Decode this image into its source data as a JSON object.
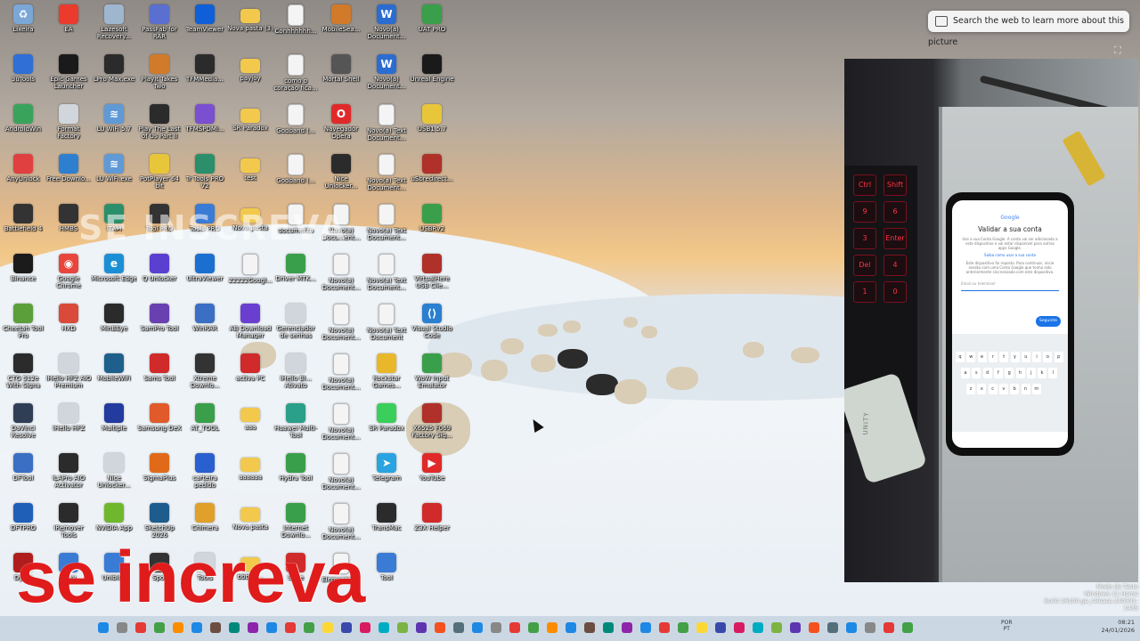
{
  "desktop": {
    "icons": [
      {
        "label": "Lixeira",
        "icon": "recycle-bin-icon",
        "color": "#7aa7d6"
      },
      {
        "label": "3uTools",
        "icon": "app-icon",
        "color": "#2f6fd6"
      },
      {
        "label": "AndroidWin",
        "icon": "app-icon",
        "color": "#3aa35b"
      },
      {
        "label": "AnyUnlock",
        "icon": "app-icon",
        "color": "#e04040"
      },
      {
        "label": "Battlefield 4",
        "icon": "app-icon",
        "color": "#333333"
      },
      {
        "label": "Binance",
        "icon": "app-icon",
        "color": "#1b1b1b"
      },
      {
        "label": "Cheetah Tool Pro",
        "icon": "app-icon",
        "color": "#5a9f3a"
      },
      {
        "label": "CTG 512e With Signa",
        "icon": "app-icon",
        "color": "#2b2b2b"
      },
      {
        "label": "DaVinci Resolve",
        "icon": "app-icon",
        "color": "#2f3e54"
      },
      {
        "label": "DFTool",
        "icon": "app-icon",
        "color": "#3a6fc4"
      },
      {
        "label": "DFTPRO",
        "icon": "app-icon",
        "color": "#1f5fb8"
      },
      {
        "label": "Dying",
        "icon": "app-icon",
        "color": "#b01d1d"
      },
      {
        "label": "EA",
        "icon": "app-icon",
        "color": "#ea3b2d"
      },
      {
        "label": "Epic Games Launcher",
        "icon": "app-icon",
        "color": "#1a1a1a"
      },
      {
        "label": "Format Factory",
        "icon": "app-icon",
        "color": "#d0d6dc"
      },
      {
        "label": "Free Downlo...",
        "icon": "app-icon",
        "color": "#2e7fd0"
      },
      {
        "label": "HMBS",
        "icon": "app-icon",
        "color": "#333333"
      },
      {
        "label": "Google Chrome",
        "icon": "chrome-icon",
        "color": "#e8453c"
      },
      {
        "label": "HXD",
        "icon": "app-icon",
        "color": "#d94a3b"
      },
      {
        "label": "iHello HFZ AIO Premium",
        "icon": "app-icon",
        "color": "#d0d6dc"
      },
      {
        "label": "iHello HFZ",
        "icon": "app-icon",
        "color": "#d0d6dc"
      },
      {
        "label": "iLAPro AIO Activator",
        "icon": "app-icon",
        "color": "#2b2b2b"
      },
      {
        "label": "iRemover Tools",
        "icon": "app-icon",
        "color": "#2b2b2b"
      },
      {
        "label": "iPlay",
        "icon": "app-icon",
        "color": "#3a7bd5"
      },
      {
        "label": "Lazesoft Recovery...",
        "icon": "app-icon",
        "color": "#9fb6cf"
      },
      {
        "label": "LPro Max.exe",
        "icon": "app-icon",
        "color": "#2b2b2b"
      },
      {
        "label": "LU WiFi 5.7",
        "icon": "wifi-icon",
        "color": "#5f9ad6"
      },
      {
        "label": "LU WiFi.exe",
        "icon": "wifi-icon",
        "color": "#5f9ad6"
      },
      {
        "label": "ITAM",
        "icon": "app-icon",
        "color": "#2a8f6a"
      },
      {
        "label": "Microsoft Edge",
        "icon": "edge-icon",
        "color": "#1a8fd6"
      },
      {
        "label": "MinBEye",
        "icon": "app-icon",
        "color": "#2b2b2b"
      },
      {
        "label": "MobileWiFi",
        "icon": "app-icon",
        "color": "#1e5f8c"
      },
      {
        "label": "Multiple",
        "icon": "app-icon",
        "color": "#233a9e"
      },
      {
        "label": "Nice Unlocker...",
        "icon": "app-icon",
        "color": "#d0d6dc"
      },
      {
        "label": "NVIDIA App",
        "icon": "app-icon",
        "color": "#6fb82d"
      },
      {
        "label": "Uniblue",
        "icon": "app-icon",
        "color": "#3a7bd5"
      },
      {
        "label": "PassFab for RAR",
        "icon": "app-icon",
        "color": "#5a6fd0"
      },
      {
        "label": "PlayIt Takes Two",
        "icon": "app-icon",
        "color": "#d07a2a"
      },
      {
        "label": "Play The Last of Us Part II",
        "icon": "app-icon",
        "color": "#2b2b2b"
      },
      {
        "label": "PotPlayer 64 bit",
        "icon": "app-icon",
        "color": "#e8c63a"
      },
      {
        "label": "Tool PRO",
        "icon": "app-icon",
        "color": "#333333"
      },
      {
        "label": "Q Unlocker",
        "icon": "app-icon",
        "color": "#5a3fd0"
      },
      {
        "label": "SamPro Tool",
        "icon": "app-icon",
        "color": "#6a3fb0"
      },
      {
        "label": "Sams Tool",
        "icon": "app-icon",
        "color": "#d02a2a"
      },
      {
        "label": "Samsung DeX",
        "icon": "app-icon",
        "color": "#e05a2a"
      },
      {
        "label": "SigmaPlus",
        "icon": "app-icon",
        "color": "#e06a1a"
      },
      {
        "label": "SketchUp 2026",
        "icon": "app-icon",
        "color": "#1d5c8c"
      },
      {
        "label": "Spot",
        "icon": "app-icon",
        "color": "#333333"
      },
      {
        "label": "TeamViewer",
        "icon": "app-icon",
        "color": "#0e5fd8"
      },
      {
        "label": "TFMMedia...",
        "icon": "app-icon",
        "color": "#2b2b2b"
      },
      {
        "label": "TFMSPDMi...",
        "icon": "app-icon",
        "color": "#7a4fd0"
      },
      {
        "label": "Tr Tools PRO V2",
        "icon": "app-icon",
        "color": "#2a8f6a"
      },
      {
        "label": "Tools PRO",
        "icon": "app-icon",
        "color": "#3a7bd5"
      },
      {
        "label": "UltraViewer",
        "icon": "app-icon",
        "color": "#1a6fd0"
      },
      {
        "label": "WinRAR",
        "icon": "app-icon",
        "color": "#3a6fc4"
      },
      {
        "label": "Xtreme Downlo...",
        "icon": "app-icon",
        "color": "#333333"
      },
      {
        "label": "AT_TOOL",
        "icon": "app-icon",
        "color": "#3a9f4a"
      },
      {
        "label": "carteira pedido",
        "icon": "app-icon",
        "color": "#2a5fd0"
      },
      {
        "label": "Chimera",
        "icon": "app-icon",
        "color": "#e0a02a"
      },
      {
        "label": "Tools",
        "icon": "app-icon",
        "color": "#d0d6dc"
      },
      {
        "label": "Nova pasta (3)",
        "icon": "folder-icon",
        "color": "#f2c94c"
      },
      {
        "label": "payjoy",
        "icon": "folder-icon",
        "color": "#f2c94c"
      },
      {
        "label": "SR Paradox",
        "icon": "folder-icon",
        "color": "#f2c94c"
      },
      {
        "label": "test",
        "icon": "folder-icon",
        "color": "#f2c94c"
      },
      {
        "label": "Nova pasta",
        "icon": "folder-icon",
        "color": "#f2c94c"
      },
      {
        "label": "22222Googl...",
        "icon": "document-icon",
        "color": "#f4f4f4"
      },
      {
        "label": "AB Download Manager",
        "icon": "app-icon",
        "color": "#6a3fd0"
      },
      {
        "label": "activa PC",
        "icon": "app-icon",
        "color": "#d02a2a"
      },
      {
        "label": "aaa",
        "icon": "folder-icon",
        "color": "#f2c94c"
      },
      {
        "label": "aaaaaa",
        "icon": "folder-icon",
        "color": "#f2c94c"
      },
      {
        "label": "Nova pasta",
        "icon": "folder-icon",
        "color": "#f2c94c"
      },
      {
        "label": "bbbbb...",
        "icon": "folder-icon",
        "color": "#f2c94c"
      },
      {
        "label": "Conhhhhhh...",
        "icon": "document-icon",
        "color": "#f4f4f4"
      },
      {
        "label": "como o coração fica...",
        "icon": "document-icon",
        "color": "#f4f4f4"
      },
      {
        "label": "Godband (...",
        "icon": "document-icon",
        "color": "#f4f4f4"
      },
      {
        "label": "Godband (...",
        "icon": "document-icon",
        "color": "#f4f4f4"
      },
      {
        "label": "documento",
        "icon": "document-icon",
        "color": "#f4f4f4"
      },
      {
        "label": "Driver MTK...",
        "icon": "app-icon",
        "color": "#3a9f4a"
      },
      {
        "label": "Gerenciador de senhas",
        "icon": "app-icon",
        "color": "#d0d6dc"
      },
      {
        "label": "iHello Bl... Ativato",
        "icon": "app-icon",
        "color": "#d0d6dc"
      },
      {
        "label": "Huawei Multi-Tool",
        "icon": "app-icon",
        "color": "#2a9f8a"
      },
      {
        "label": "Hydra Tool",
        "icon": "app-icon",
        "color": "#3a9f4a"
      },
      {
        "label": "Internet Downlo...",
        "icon": "app-icon",
        "color": "#3a9f4a"
      },
      {
        "label": "Suite",
        "icon": "app-icon",
        "color": "#d02a2a"
      },
      {
        "label": "MobileSea...",
        "icon": "app-icon",
        "color": "#d07a2a"
      },
      {
        "label": "Mortal Shell",
        "icon": "app-icon",
        "color": "#555555"
      },
      {
        "label": "Navegador Opera",
        "icon": "opera-icon",
        "color": "#e02a2a"
      },
      {
        "label": "Nice Unlocker...",
        "icon": "app-icon",
        "color": "#2b2b2b"
      },
      {
        "label": "Novo(a) Document...",
        "icon": "document-icon",
        "color": "#f4f4f4"
      },
      {
        "label": "Novo(a) Document...",
        "icon": "document-icon",
        "color": "#f4f4f4"
      },
      {
        "label": "Novo(a) Document...",
        "icon": "document-icon",
        "color": "#f4f4f4"
      },
      {
        "label": "Novo(a) Document...",
        "icon": "document-icon",
        "color": "#f4f4f4"
      },
      {
        "label": "Novo(a) Document...",
        "icon": "document-icon",
        "color": "#f4f4f4"
      },
      {
        "label": "Novo(a) Document...",
        "icon": "document-icon",
        "color": "#f4f4f4"
      },
      {
        "label": "Novo(a) Document...",
        "icon": "document-icon",
        "color": "#f4f4f4"
      },
      {
        "label": "Elementos...",
        "icon": "document-icon",
        "color": "#f4f4f4"
      },
      {
        "label": "Novo(a) Document...",
        "icon": "word-icon",
        "color": "#2b6cd0"
      },
      {
        "label": "Novo(a) Document...",
        "icon": "word-icon",
        "color": "#2b6cd0"
      },
      {
        "label": "Novo(a) Text Document...",
        "icon": "document-icon",
        "color": "#f4f4f4"
      },
      {
        "label": "Novo(a) Text Document...",
        "icon": "document-icon",
        "color": "#f4f4f4"
      },
      {
        "label": "Novo(a) Text Document...",
        "icon": "document-icon",
        "color": "#f4f4f4"
      },
      {
        "label": "Novo(a) Text Document...",
        "icon": "document-icon",
        "color": "#f4f4f4"
      },
      {
        "label": "Novo(a) Text Document",
        "icon": "document-icon",
        "color": "#f4f4f4"
      },
      {
        "label": "Rockstar Games...",
        "icon": "app-icon",
        "color": "#e8b82a"
      },
      {
        "label": "SR Paradox",
        "icon": "app-icon",
        "color": "#3acf5a"
      },
      {
        "label": "Telegram",
        "icon": "telegram-icon",
        "color": "#2aa3e0"
      },
      {
        "label": "TransMac",
        "icon": "app-icon",
        "color": "#2b2b2b"
      },
      {
        "label": "Tool",
        "icon": "app-icon",
        "color": "#3a7bd5"
      },
      {
        "label": "UAT PRO",
        "icon": "app-icon",
        "color": "#3a9f4a"
      },
      {
        "label": "Unreal Engine",
        "icon": "app-icon",
        "color": "#1a1a1a"
      },
      {
        "label": "USB1.5.7",
        "icon": "app-icon",
        "color": "#e8c63a"
      },
      {
        "label": "uSbredirect...",
        "icon": "app-icon",
        "color": "#b0302a"
      },
      {
        "label": "USBRv2",
        "icon": "app-icon",
        "color": "#3a9f4a"
      },
      {
        "label": "VirtualHere USB Clie...",
        "icon": "app-icon",
        "color": "#b0302a"
      },
      {
        "label": "Visual Studio Code",
        "icon": "vscode-icon",
        "color": "#2a7fd0"
      },
      {
        "label": "WoW Input Emulator",
        "icon": "app-icon",
        "color": "#3a9f4a"
      },
      {
        "label": "X6525 F069 Factory Sig...",
        "icon": "app-icon",
        "color": "#b0302a"
      },
      {
        "label": "YouTube",
        "icon": "youtube-icon",
        "color": "#e02a2a"
      },
      {
        "label": "Z3X Helper",
        "icon": "app-icon",
        "color": "#d02a2a"
      }
    ]
  },
  "lens": {
    "banner_text": "Search the web to learn more about this picture"
  },
  "camera": {
    "keyboard_keys": [
      "Ctrl",
      "Shift",
      "9",
      "6",
      "3",
      "Enter",
      "Del",
      "4",
      "1",
      "0"
    ],
    "phone": {
      "logo": "Google",
      "title": "Validar a sua conta",
      "text": "Use a sua Conta Google. A conta vai ser adicionada a este dispositivo e vai estar disponível para outras apps Google.",
      "link": "Saiba como usar a sua conta",
      "text2": "Este dispositivo foi reposto. Para continuar, inicie sessão com uma Conta Google que tenha sido anteriormente sincronizada com este dispositivo.",
      "input_placeholder": "Email ou telemóvel",
      "next_label": "Seguinte",
      "keys_row1": [
        "q",
        "w",
        "e",
        "r",
        "t",
        "y",
        "u",
        "i",
        "o",
        "p"
      ],
      "keys_row2": [
        "a",
        "s",
        "d",
        "f",
        "g",
        "h",
        "j",
        "k",
        "l"
      ],
      "keys_row3": [
        "z",
        "x",
        "c",
        "v",
        "b",
        "n",
        "m"
      ]
    },
    "tag_text": "UNITY"
  },
  "overlay": {
    "watermark": "SE INSCREVA",
    "subscribe_text": "se increva"
  },
  "taskbar": {
    "lang_top": "POR",
    "lang_bottom": "PT",
    "time": "08:21",
    "date": "24/01/2026"
  },
  "windows_watermark": {
    "line1": "Modo de Teste",
    "line2": "Windows 11 Home",
    "line3": "Build 26100.ge_release.240331-1435"
  }
}
